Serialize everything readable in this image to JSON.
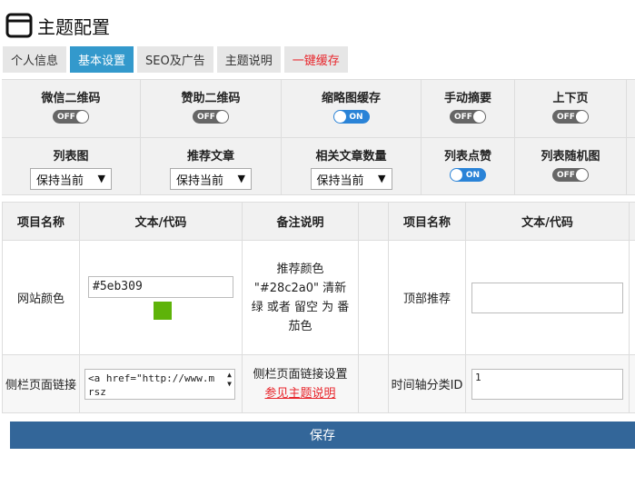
{
  "page_title": "主题配置",
  "tabs": [
    {
      "label": "个人信息"
    },
    {
      "label": "基本设置"
    },
    {
      "label": "SEO及广告"
    },
    {
      "label": "主题说明"
    },
    {
      "label": "一键缓存"
    }
  ],
  "switches_row1": [
    {
      "label": "微信二维码",
      "state": "OFF"
    },
    {
      "label": "赞助二维码",
      "state": "OFF"
    },
    {
      "label": "缩略图缓存",
      "state": "ON"
    },
    {
      "label": "手动摘要",
      "state": "OFF"
    },
    {
      "label": "上下页",
      "state": "OFF"
    }
  ],
  "row2": {
    "list_layout": {
      "label": "列表图",
      "selected": "保持当前"
    },
    "recommended": {
      "label": "推荐文章",
      "selected": "保持当前"
    },
    "related_count": {
      "label": "相关文章数量",
      "selected": "保持当前"
    },
    "list_like": {
      "label": "列表点赞",
      "state": "ON"
    },
    "list_random": {
      "label": "列表随机图",
      "state": "OFF"
    }
  },
  "table": {
    "headers": [
      "项目名称",
      "文本/代码",
      "备注说明",
      "项目名称",
      "文本/代码"
    ],
    "row1": {
      "name": "网站颜色",
      "value": "#5eb309",
      "swatch_color": "#5eb309",
      "note": "推荐颜色 \"#28c2a0\" 清新绿 或者 留空 为 番茄色",
      "name2": "顶部推荐",
      "value2": ""
    },
    "row2": {
      "name": "侧栏页面链接",
      "value": "<a href=\"http://www.mrsz",
      "note": "侧栏页面链接设置",
      "note_link": "参见主题说明",
      "name2": "时间轴分类ID",
      "value2": "1"
    }
  },
  "save_label": "保存",
  "colors": {
    "accent": "#3399cc",
    "save": "#336699",
    "on": "#2a83d7",
    "off": "#666666",
    "danger": "#e8262c"
  }
}
